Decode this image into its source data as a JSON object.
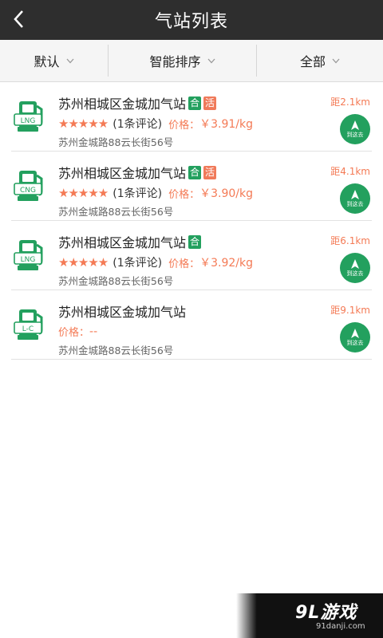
{
  "header": {
    "title": "气站列表",
    "back_icon": "back-arrow-icon"
  },
  "filters": [
    {
      "label": "默认"
    },
    {
      "label": "智能排序"
    },
    {
      "label": "全部"
    }
  ],
  "stations": [
    {
      "icon_text": "LNG",
      "name": "苏州相城区金城加气站",
      "tag_he": "合",
      "tag_huo": "活",
      "stars": "★★★★★",
      "reviews": "(1条评论)",
      "price_label": "价格：",
      "price": "￥3.91/kg",
      "address": "苏州金城路88云长街56号",
      "distance": "距2.1km",
      "nav_label": "到这去"
    },
    {
      "icon_text": "CNG",
      "name": "苏州相城区金城加气站",
      "tag_he": "合",
      "tag_huo": "活",
      "stars": "★★★★★",
      "reviews": "(1条评论)",
      "price_label": "价格：",
      "price": "￥3.90/kg",
      "address": "苏州金城路88云长街56号",
      "distance": "距4.1km",
      "nav_label": "到这去"
    },
    {
      "icon_text": "LNG",
      "name": "苏州相城区金城加气站",
      "tag_he": "合",
      "stars": "★★★★★",
      "reviews": "(1条评论)",
      "price_label": "价格：",
      "price": "￥3.92/kg",
      "address": "苏州金城路88云长街56号",
      "distance": "距6.1km",
      "nav_label": "到这去"
    },
    {
      "icon_text": "L-C",
      "name": "苏州相城区金城加气站",
      "price_label": "价格：",
      "price": "--",
      "address": "苏州金城路88云长街56号",
      "distance": "距9.1km",
      "nav_label": "到这去"
    }
  ],
  "watermark": {
    "logo": "9L游戏",
    "url": "91danji.com"
  },
  "colors": {
    "header_bg": "#2e2e2e",
    "green": "#23a05e",
    "orange": "#f47a55",
    "tag_orange": "#f07a5a"
  }
}
